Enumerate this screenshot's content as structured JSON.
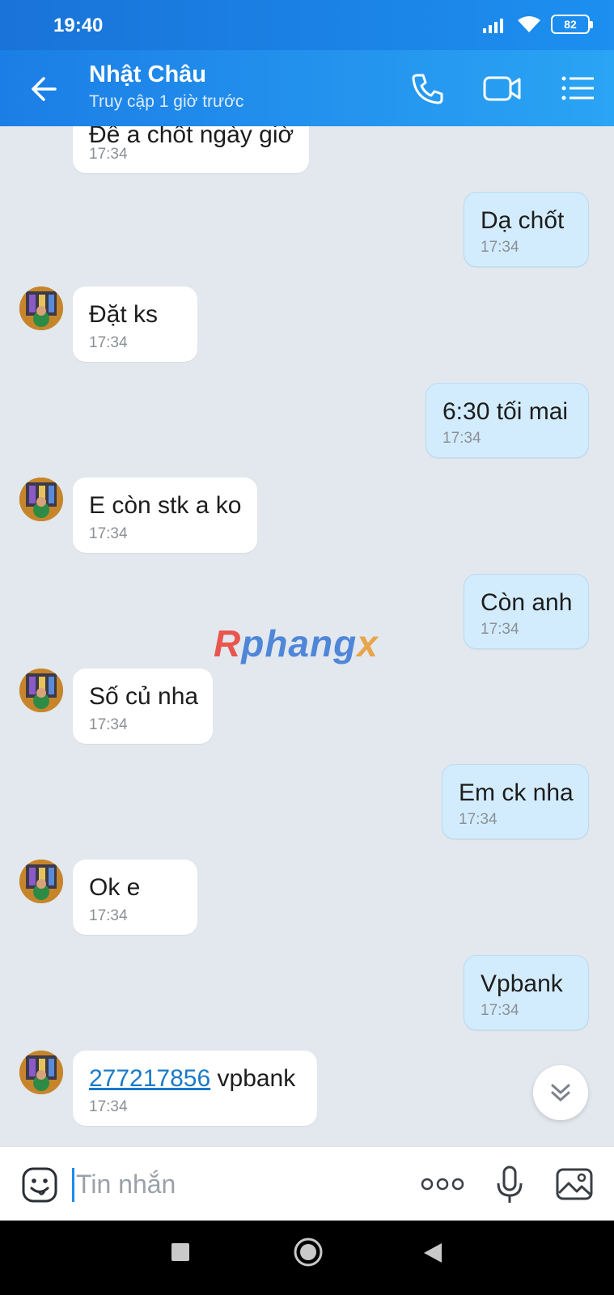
{
  "status_bar": {
    "time": "19:40",
    "battery": "82"
  },
  "header": {
    "contact_name": "Nhật Châu",
    "last_seen": "Truy cập 1 giờ trước"
  },
  "watermark": {
    "part1": "R",
    "part2": "phang",
    "part3": "x"
  },
  "messages": [
    {
      "direction": "in",
      "text": "Để a chốt ngày giờ",
      "time": "17:34"
    },
    {
      "direction": "out",
      "text": "Dạ chốt",
      "time": "17:34"
    },
    {
      "direction": "in",
      "text": "Đặt ks",
      "time": "17:34"
    },
    {
      "direction": "out",
      "text": "6:30 tối mai",
      "time": "17:34"
    },
    {
      "direction": "in",
      "text": "E còn stk a ko",
      "time": "17:34"
    },
    {
      "direction": "out",
      "text": "Còn anh",
      "time": "17:34"
    },
    {
      "direction": "in",
      "text": "Số củ nha",
      "time": "17:34"
    },
    {
      "direction": "out",
      "text": "Em ck nha",
      "time": "17:34"
    },
    {
      "direction": "in",
      "text": "Ok e",
      "time": "17:34"
    },
    {
      "direction": "out",
      "text": "Vpbank",
      "time": "17:34"
    },
    {
      "direction": "in",
      "link_text": "277217856",
      "text": " vpbank",
      "time": "17:34"
    }
  ],
  "composer": {
    "placeholder": "Tin nhắn"
  },
  "colors": {
    "header": "#1b7ee6",
    "incoming_bubble": "#ffffff",
    "outgoing_bubble": "#d3ecfd",
    "link": "#1a79c8",
    "chat_bg": "#e2e8ee"
  },
  "icons": [
    "back-arrow-icon",
    "phone-icon",
    "video-call-icon",
    "menu-list-icon",
    "scroll-down-icon",
    "emoji-icon",
    "more-icon",
    "mic-icon",
    "image-icon"
  ]
}
